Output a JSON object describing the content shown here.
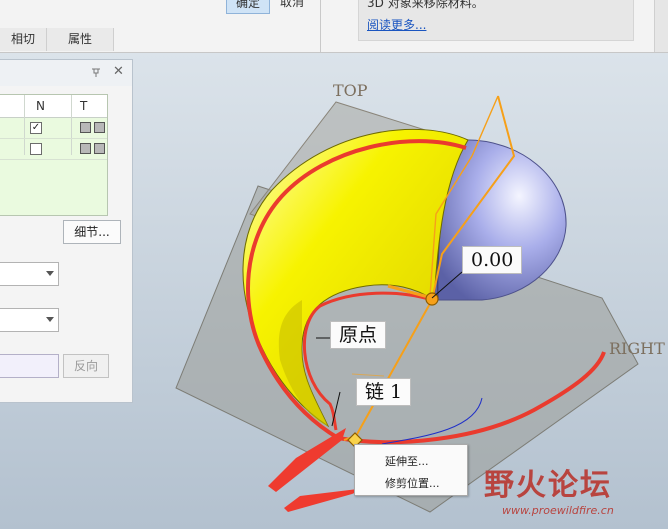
{
  "ribbon": {
    "tabs": [
      {
        "label": "相切"
      },
      {
        "label": "属性"
      }
    ],
    "ok_label": "确定",
    "cancel_label": "取消",
    "info_text": "3D 对象来移除材料。",
    "info_link": "阅读更多..."
  },
  "panel": {
    "columns": {
      "n": "N",
      "t": "T"
    },
    "rows": [
      {
        "n_checked": true
      },
      {
        "n_checked": false
      }
    ],
    "detail_button": "细节...",
    "reverse_button": "反向"
  },
  "viewport": {
    "plane_labels": {
      "top": "TOP",
      "right": "RIGHT"
    },
    "dimension_value": "0.00",
    "origin_label": "原点",
    "chain_label": "链 1"
  },
  "context_menu": {
    "items": [
      {
        "label": "延伸至..."
      },
      {
        "label": "修剪位置..."
      }
    ]
  },
  "watermark": {
    "title": "野火论坛",
    "url": "www.proewildfire.cn"
  },
  "colors": {
    "surface_yellow": "#f5f200",
    "sphere_blue": "#a8aee8",
    "plane_gray": "#9a9c98",
    "curve_red": "#ea3b2e",
    "orange": "#f6a019",
    "arrow_red": "#ef3b2f"
  }
}
